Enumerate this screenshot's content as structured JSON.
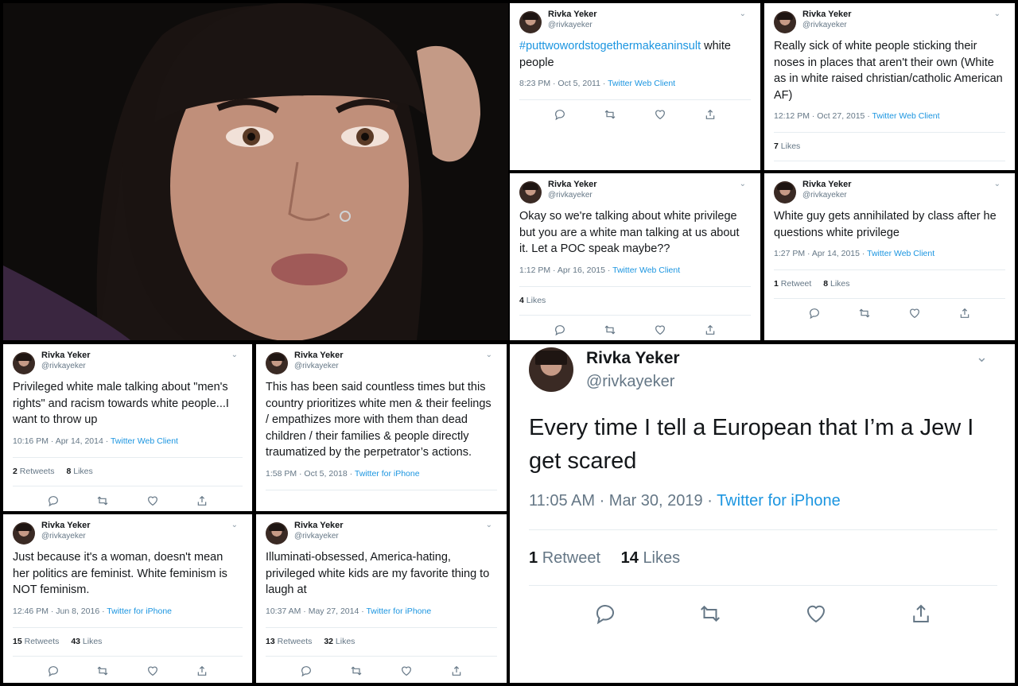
{
  "profile": {
    "name": "Rivka Yeker",
    "handle": "@rivkayeker"
  },
  "tweets": [
    {
      "id": "t1",
      "hashtag": "#puttwowordstogethermakeaninsult",
      "text": " white people",
      "time": "8:23 PM · Oct 5, 2011 · ",
      "client": "Twitter Web Client",
      "retweets": "",
      "retweets_label": "",
      "likes": "",
      "likes_label": ""
    },
    {
      "id": "t2",
      "hashtag": "",
      "text": "Really sick of white people sticking their noses in places that aren't their own (White as in white raised christian/catholic American AF)",
      "time": "12:12 PM · Oct 27, 2015 · ",
      "client": "Twitter Web Client",
      "retweets": "",
      "retweets_label": "",
      "likes": "7",
      "likes_label": "Likes"
    },
    {
      "id": "t3",
      "hashtag": "",
      "text": "Okay so we're talking about white privilege but you are a white man talking at us about it. Let a POC speak maybe??",
      "time": "1:12 PM · Apr 16, 2015 · ",
      "client": "Twitter Web Client",
      "retweets": "",
      "retweets_label": "",
      "likes": "4",
      "likes_label": "Likes"
    },
    {
      "id": "t4",
      "hashtag": "",
      "text": "White guy gets annihilated by class after he questions white privilege",
      "time": "1:27 PM · Apr 14, 2015 · ",
      "client": "Twitter Web Client",
      "retweets": "1",
      "retweets_label": "Retweet",
      "likes": "8",
      "likes_label": "Likes"
    },
    {
      "id": "t5",
      "hashtag": "",
      "text": "Privileged white male talking about \"men's rights\" and racism towards white people...I want to throw up",
      "time": "10:16 PM · Apr 14, 2014 · ",
      "client": "Twitter Web Client",
      "retweets": "2",
      "retweets_label": "Retweets",
      "likes": "8",
      "likes_label": "Likes"
    },
    {
      "id": "t6",
      "hashtag": "",
      "text": "This has been said countless times but this country prioritizes white men & their feelings / empathizes more with them than dead children / their families & people directly traumatized by the perpetrator’s actions.",
      "time": "1:58 PM · Oct 5, 2018 · ",
      "client": "Twitter for iPhone",
      "retweets": "",
      "retweets_label": "",
      "likes": "",
      "likes_label": ""
    },
    {
      "id": "t7",
      "hashtag": "",
      "text": "Just because it's a woman, doesn't mean her politics are feminist. White feminism is NOT feminism.",
      "time": "12:46 PM · Jun 8, 2016 · ",
      "client": "Twitter for iPhone",
      "retweets": "15",
      "retweets_label": "Retweets",
      "likes": "43",
      "likes_label": "Likes"
    },
    {
      "id": "t8",
      "hashtag": "",
      "text": "Illuminati-obsessed, America-hating, privileged white kids are my favorite thing to laugh at",
      "time": "10:37 AM · May 27, 2014 · ",
      "client": "Twitter for iPhone",
      "retweets": "13",
      "retweets_label": "Retweets",
      "likes": "32",
      "likes_label": "Likes"
    },
    {
      "id": "t9",
      "hashtag": "",
      "text": "Every time I tell a European that I’m a Jew I get scared",
      "time": "11:05 AM · Mar 30, 2019 · ",
      "client": "Twitter for iPhone",
      "retweets": "1",
      "retweets_label": "Retweet",
      "likes": "14",
      "likes_label": "Likes"
    }
  ],
  "icons": {
    "reply": "reply-icon",
    "retweet": "retweet-icon",
    "like": "heart-icon",
    "share": "share-icon",
    "menu": "chevron-down-icon"
  },
  "colors": {
    "link": "#1b95e0",
    "muted": "#657786",
    "divider": "#e6ecf0"
  }
}
